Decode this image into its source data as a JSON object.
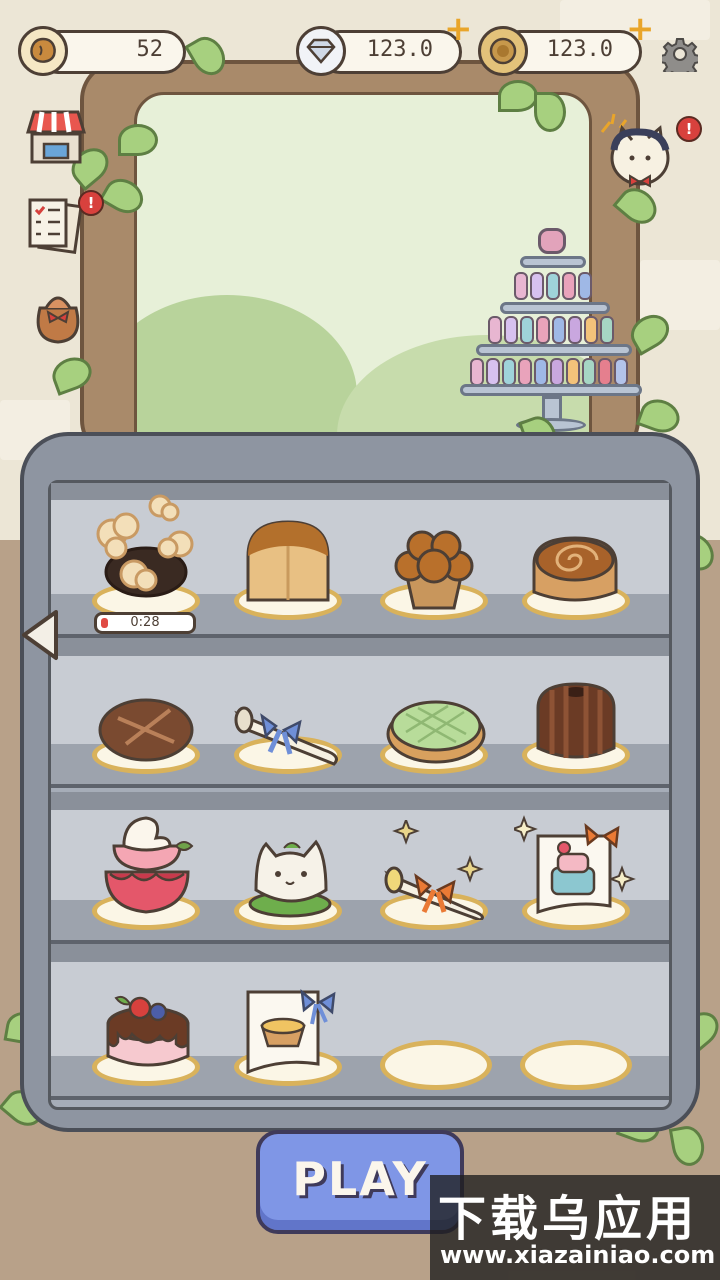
{
  "currencies": {
    "cookies": {
      "value": "52",
      "icon": "cookie-icon"
    },
    "diamonds": {
      "value": "123.0",
      "icon": "diamond-icon"
    },
    "coins": {
      "value": "123.0",
      "icon": "coin-icon"
    }
  },
  "side_menu": [
    {
      "name": "shop",
      "icon": "shop-stall-icon"
    },
    {
      "name": "recipes",
      "icon": "recipe-list-icon",
      "badge": "!"
    },
    {
      "name": "bag",
      "icon": "gift-bag-icon"
    }
  ],
  "cat_profile": {
    "icon": "cat-chef-icon",
    "badge": "!"
  },
  "shelves": [
    {
      "row": 1,
      "items": [
        {
          "name": "baking-item",
          "state": "baking",
          "timer": "0:28",
          "progress": 0.08
        },
        {
          "name": "bread-loaf"
        },
        {
          "name": "muffin"
        },
        {
          "name": "cinnamon-roll"
        }
      ]
    },
    {
      "row": 2,
      "items": [
        {
          "name": "chocolate-bread"
        },
        {
          "name": "recipe-scroll-blue"
        },
        {
          "name": "melon-pan"
        },
        {
          "name": "chocolate-bundt"
        }
      ]
    },
    {
      "row": 3,
      "items": [
        {
          "name": "strawberry-pudding"
        },
        {
          "name": "cat-mochi"
        },
        {
          "name": "recipe-scroll-orange"
        },
        {
          "name": "cake-recipe-card"
        }
      ]
    },
    {
      "row": 4,
      "items": [
        {
          "name": "berry-chocolate-cake"
        },
        {
          "name": "tart-recipe-card"
        },
        {
          "name": "empty-plate"
        },
        {
          "name": "empty-plate"
        }
      ]
    }
  ],
  "play_button": {
    "label": "PLAY"
  },
  "watermark": {
    "title": "下载乌应用",
    "url": "www.xiazainiao.com"
  },
  "colors": {
    "accent": "#7f96e6",
    "plus": "#e9a52a",
    "badge": "#d8413d",
    "plate_rim": "#d9b25b"
  }
}
